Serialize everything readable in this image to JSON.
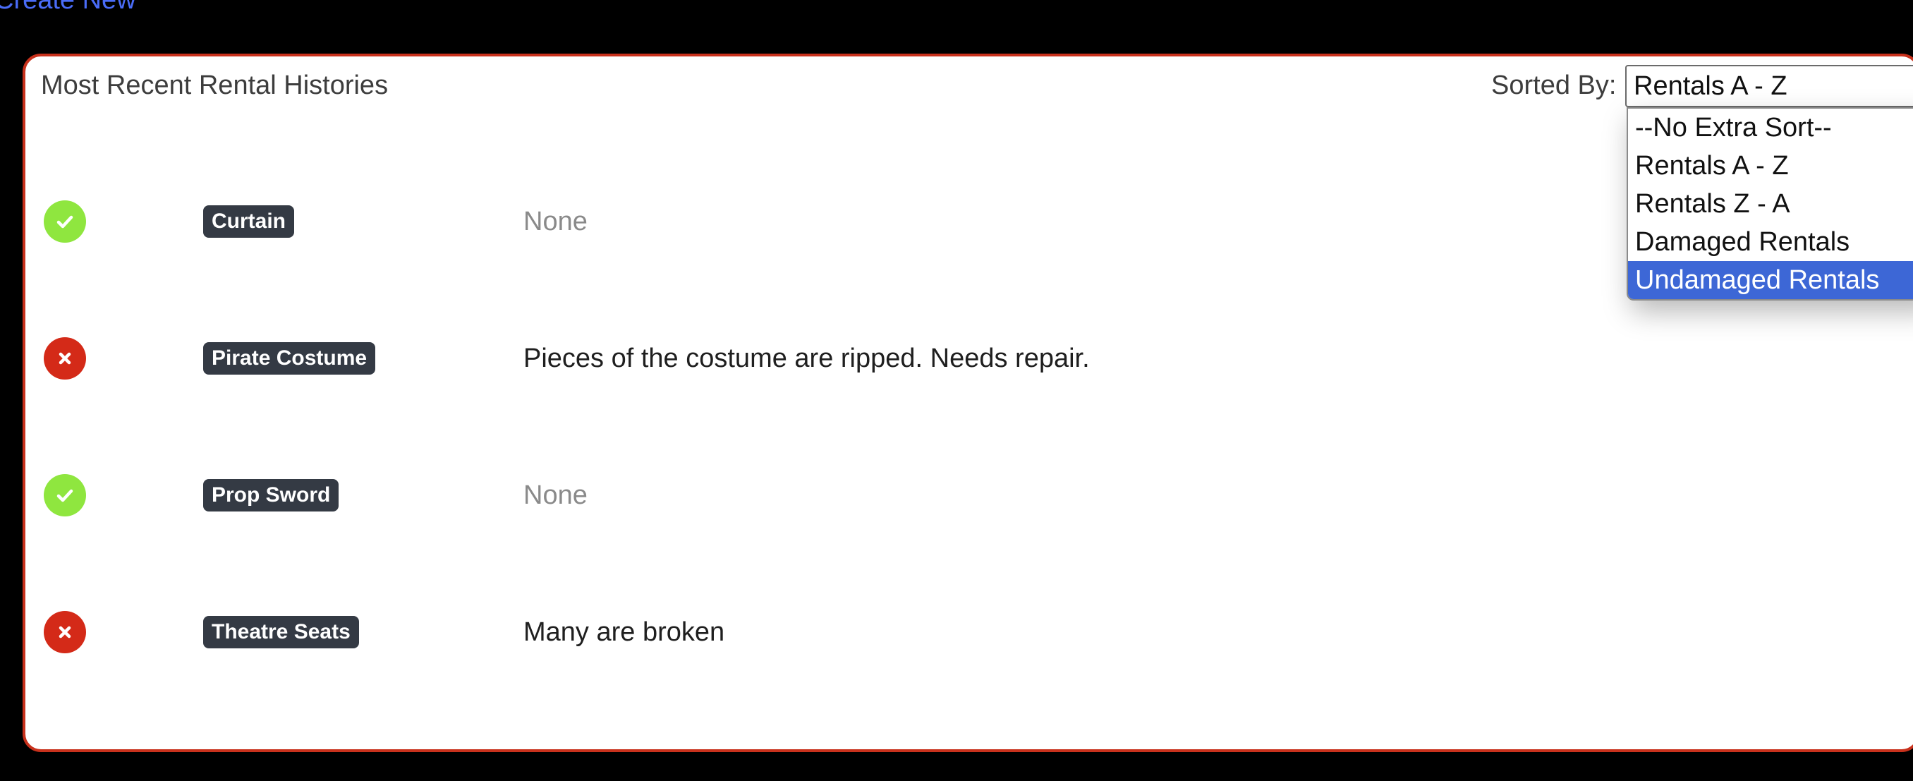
{
  "header": {
    "create_new_label": "Create New"
  },
  "card": {
    "title": "Most Recent Rental Histories",
    "sort_label": "Sorted By:",
    "sort_selected": "Rentals A - Z",
    "sort_options": [
      "--No Extra Sort--",
      "Rentals A - Z",
      "Rentals Z - A",
      "Damaged Rentals",
      "Undamaged Rentals"
    ],
    "highlighted_option": "Undamaged Rentals"
  },
  "rentals": [
    {
      "status": "undamaged",
      "status_icon": "check-icon",
      "name": "Curtain",
      "notes": "None"
    },
    {
      "status": "damaged",
      "status_icon": "x-icon",
      "name": "Pirate Costume",
      "notes": "Pieces of the costume are ripped. Needs repair."
    },
    {
      "status": "undamaged",
      "status_icon": "check-icon",
      "name": "Prop Sword",
      "notes": "None"
    },
    {
      "status": "damaged",
      "status_icon": "x-icon",
      "name": "Theatre Seats",
      "notes": "Many are broken"
    }
  ],
  "colors": {
    "background": "#000000",
    "card_border": "#c8311c",
    "link": "#4a6cf7",
    "ok": "#8fe63f",
    "bad": "#d42a18",
    "badge": "#343a44",
    "selected_option": "#3d67d6"
  }
}
